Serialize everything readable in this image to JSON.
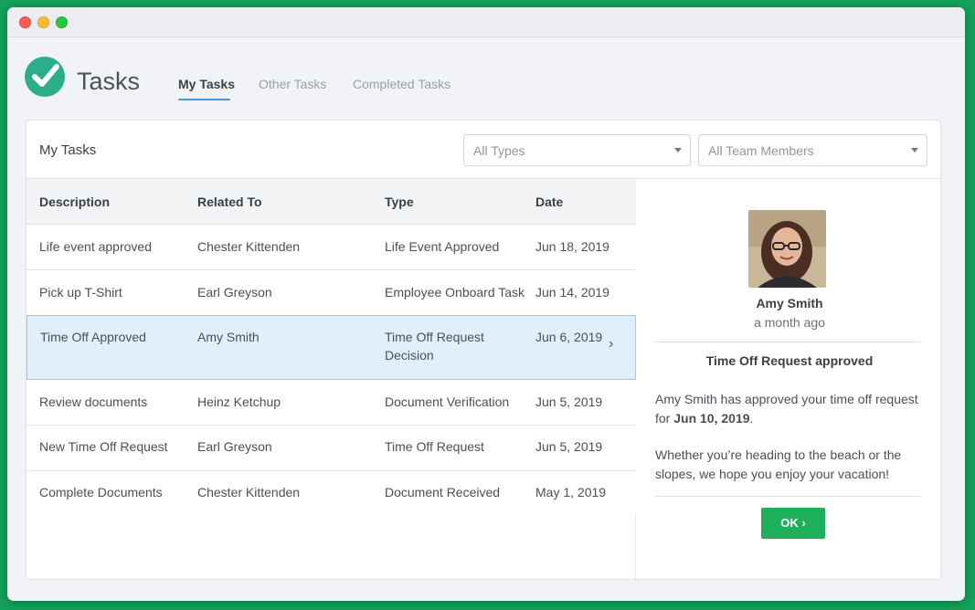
{
  "app": {
    "title": "Tasks"
  },
  "tabs": [
    {
      "label": "My Tasks",
      "active": true
    },
    {
      "label": "Other Tasks",
      "active": false
    },
    {
      "label": "Completed Tasks",
      "active": false
    }
  ],
  "panel": {
    "title": "My Tasks",
    "type_filter": "All Types",
    "member_filter": "All Team Members"
  },
  "table": {
    "columns": [
      "Description",
      "Related To",
      "Type",
      "Date"
    ],
    "rows": [
      {
        "description": "Life event approved",
        "related_to": "Chester Kittenden",
        "type": "Life Event Approved",
        "date": "Jun 18, 2019",
        "selected": false
      },
      {
        "description": "Pick up T-Shirt",
        "related_to": "Earl Greyson",
        "type": "Employee Onboard Task",
        "date": "Jun 14, 2019",
        "selected": false
      },
      {
        "description": "Time Off Approved",
        "related_to": "Amy Smith",
        "type": "Time Off Request Decision",
        "date": "Jun 6, 2019",
        "selected": true
      },
      {
        "description": "Review documents",
        "related_to": "Heinz Ketchup",
        "type": "Document Verification",
        "date": "Jun 5, 2019",
        "selected": false
      },
      {
        "description": "New Time Off Request",
        "related_to": "Earl Greyson",
        "type": "Time Off Request",
        "date": "Jun 5, 2019",
        "selected": false
      },
      {
        "description": "Complete Documents",
        "related_to": "Chester Kittenden",
        "type": "Document Received",
        "date": "May 1, 2019",
        "selected": false
      }
    ]
  },
  "detail": {
    "name": "Amy Smith",
    "time": "a month ago",
    "heading": "Time Off Request approved",
    "message_prefix": "Amy Smith has approved your time off request for ",
    "message_date": "Jun 10, 2019",
    "message_suffix": ".",
    "message_2": "Whether you’re heading to the beach or the slopes, we hope you enjoy your vacation!",
    "ok_label": "OK ›"
  },
  "colors": {
    "brand": "#2cae8c",
    "accent": "#3e9be0",
    "ok_button": "#1db05a",
    "selected_row": "#e1effb"
  },
  "icons": [
    "check-logo-icon",
    "caret-down-icon",
    "chevron-right-icon"
  ]
}
